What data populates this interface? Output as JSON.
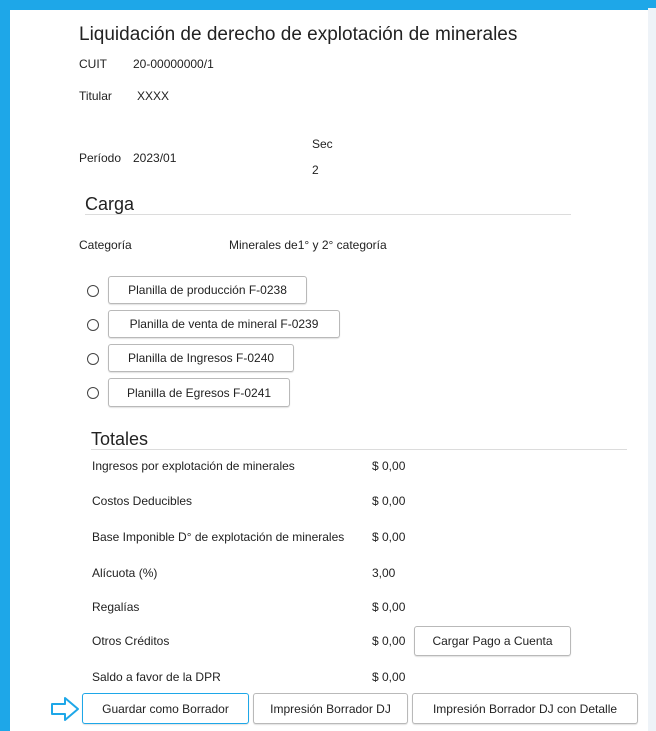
{
  "header": {
    "title": "Liquidación de derecho de explotación de minerales",
    "cuit_label": "CUIT",
    "cuit_value": "20-00000000/1",
    "titular_label": "Titular",
    "titular_value": "XXXX",
    "sec_label": "Sec",
    "sec_value": "2",
    "periodo_label": "Período",
    "periodo_value": "2023/01"
  },
  "carga": {
    "heading": "Carga",
    "categoria_label": "Categoría",
    "categoria_value": "Minerales de1° y 2° categoría",
    "options": [
      {
        "label": "Planilla de producción F-0238"
      },
      {
        "label": "Planilla de venta de mineral F-0239"
      },
      {
        "label": "Planilla de Ingresos F-0240"
      },
      {
        "label": "Planilla de Egresos F-0241"
      }
    ]
  },
  "totales": {
    "heading": "Totales",
    "rows": [
      {
        "label": "Ingresos por explotación de minerales",
        "value": "$ 0,00"
      },
      {
        "label": "Costos Deducibles",
        "value": "$ 0,00"
      },
      {
        "label": "Base Imponible D° de explotación de minerales",
        "value": "$ 0,00"
      },
      {
        "label": "Alícuota (%)",
        "value": "3,00"
      },
      {
        "label": "Regalías",
        "value": "$ 0,00"
      },
      {
        "label": "Otros Créditos",
        "value": "$ 0,00"
      },
      {
        "label": "Saldo a favor de la DPR",
        "value": "$ 0,00"
      }
    ],
    "cargar_pago_button": "Cargar Pago a Cuenta"
  },
  "actions": {
    "guardar": "Guardar como Borrador",
    "impresion": "Impresión Borrador DJ",
    "impresion_detalle": "Impresión Borrador DJ con Detalle"
  },
  "colors": {
    "frame": "#1ea7e8",
    "arrow": "#1ea7e8"
  }
}
